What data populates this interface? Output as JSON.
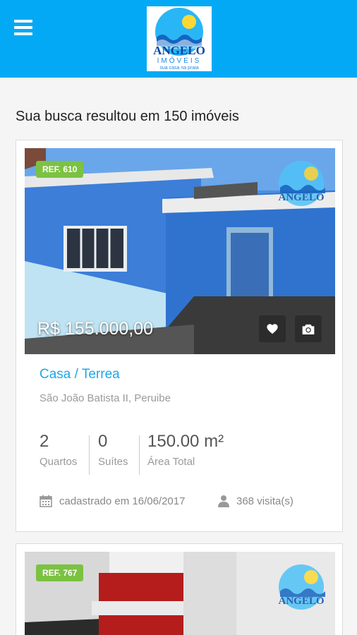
{
  "header": {
    "menu_icon": "hamburger-menu-icon",
    "logo": {
      "brand": "ANGELO",
      "sub": "IMÓVEIS",
      "tagline": "sua casa na praia"
    }
  },
  "results_text": "Sua busca resultou em 150 imóveis",
  "listings": [
    {
      "ref": "REF. 610",
      "price": "R$ 155.000,00",
      "title": "Casa / Terrea",
      "address": "São João Batista II, Peruibe",
      "stats": [
        {
          "value": "2",
          "label": "Quartos"
        },
        {
          "value": "0",
          "label": "Suítes"
        },
        {
          "value": "150.00 m²",
          "label": "Área Total"
        }
      ],
      "registered": "cadastrado em 16/06/2017",
      "visits": "368 visita(s)",
      "favorite_icon": "heart-icon",
      "photos_icon": "camera-icon"
    },
    {
      "ref": "REF. 767"
    }
  ],
  "colors": {
    "primary": "#03a9f4",
    "ref_badge": "#7cc242",
    "title_link": "#1ea7e6"
  }
}
